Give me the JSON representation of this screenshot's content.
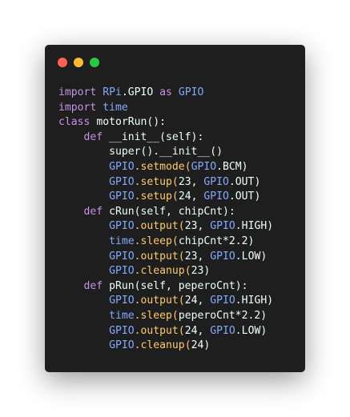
{
  "window": {
    "title_bar_buttons": [
      {
        "name": "close-button",
        "color": "#ff5f56"
      },
      {
        "name": "minimize-button",
        "color": "#ffbd2e"
      },
      {
        "name": "zoom-button",
        "color": "#27c93f"
      }
    ]
  },
  "theme": {
    "background": "#1e1e1e",
    "keyword": "#c792ea",
    "module": "#82aaff",
    "default": "#eeffff",
    "call": "#ffcb6b"
  },
  "code": {
    "lines": [
      [
        [
          "import ",
          "keyword"
        ],
        [
          "RPi",
          "module"
        ],
        [
          ".GPIO",
          "default"
        ],
        [
          " as ",
          "keyword"
        ],
        [
          "GPIO",
          "module"
        ]
      ],
      [
        [
          "import ",
          "keyword"
        ],
        [
          "time",
          "module"
        ]
      ],
      [
        [
          "class ",
          "keyword"
        ],
        [
          "motorRun():",
          "default"
        ]
      ],
      [
        [
          "    def ",
          "keyword"
        ],
        [
          "__init__(self):",
          "default"
        ]
      ],
      [
        [
          "        super().__init__()",
          "default"
        ]
      ],
      [
        [
          "        ",
          "default"
        ],
        [
          "GPIO",
          "module"
        ],
        [
          ".setmode(",
          "call"
        ],
        [
          "GPIO",
          "module"
        ],
        [
          ".BCM)",
          "default"
        ]
      ],
      [
        [
          "        ",
          "default"
        ],
        [
          "GPIO",
          "module"
        ],
        [
          ".setup(",
          "call"
        ],
        [
          "23, ",
          "default"
        ],
        [
          "GPIO",
          "module"
        ],
        [
          ".OUT)",
          "default"
        ]
      ],
      [
        [
          "        ",
          "default"
        ],
        [
          "GPIO",
          "module"
        ],
        [
          ".setup(",
          "call"
        ],
        [
          "24, ",
          "default"
        ],
        [
          "GPIO",
          "module"
        ],
        [
          ".OUT)",
          "default"
        ]
      ],
      [
        [
          "    def ",
          "keyword"
        ],
        [
          "cRun(self, chipCnt):",
          "default"
        ]
      ],
      [
        [
          "        ",
          "default"
        ],
        [
          "GPIO",
          "module"
        ],
        [
          ".output(",
          "call"
        ],
        [
          "23, ",
          "default"
        ],
        [
          "GPIO",
          "module"
        ],
        [
          ".HIGH)",
          "default"
        ]
      ],
      [
        [
          "        ",
          "default"
        ],
        [
          "time",
          "module"
        ],
        [
          ".sleep(",
          "call"
        ],
        [
          "chipCnt*2.2)",
          "default"
        ]
      ],
      [
        [
          "        ",
          "default"
        ],
        [
          "GPIO",
          "module"
        ],
        [
          ".output(",
          "call"
        ],
        [
          "23, ",
          "default"
        ],
        [
          "GPIO",
          "module"
        ],
        [
          ".LOW)",
          "default"
        ]
      ],
      [
        [
          "        ",
          "default"
        ],
        [
          "GPIO",
          "module"
        ],
        [
          ".cleanup(",
          "call"
        ],
        [
          "23)",
          "default"
        ]
      ],
      [
        [
          "    def ",
          "keyword"
        ],
        [
          "pRun(self, peperoCnt):",
          "default"
        ]
      ],
      [
        [
          "        ",
          "default"
        ],
        [
          "GPIO",
          "module"
        ],
        [
          ".output(",
          "call"
        ],
        [
          "24, ",
          "default"
        ],
        [
          "GPIO",
          "module"
        ],
        [
          ".HIGH)",
          "default"
        ]
      ],
      [
        [
          "        ",
          "default"
        ],
        [
          "time",
          "module"
        ],
        [
          ".sleep(",
          "call"
        ],
        [
          "peperoCnt*2.2)",
          "default"
        ]
      ],
      [
        [
          "        ",
          "default"
        ],
        [
          "GPIO",
          "module"
        ],
        [
          ".output(",
          "call"
        ],
        [
          "24, ",
          "default"
        ],
        [
          "GPIO",
          "module"
        ],
        [
          ".LOW)",
          "default"
        ]
      ],
      [
        [
          "        ",
          "default"
        ],
        [
          "GPIO",
          "module"
        ],
        [
          ".cleanup(",
          "call"
        ],
        [
          "24)",
          "default"
        ]
      ]
    ]
  }
}
